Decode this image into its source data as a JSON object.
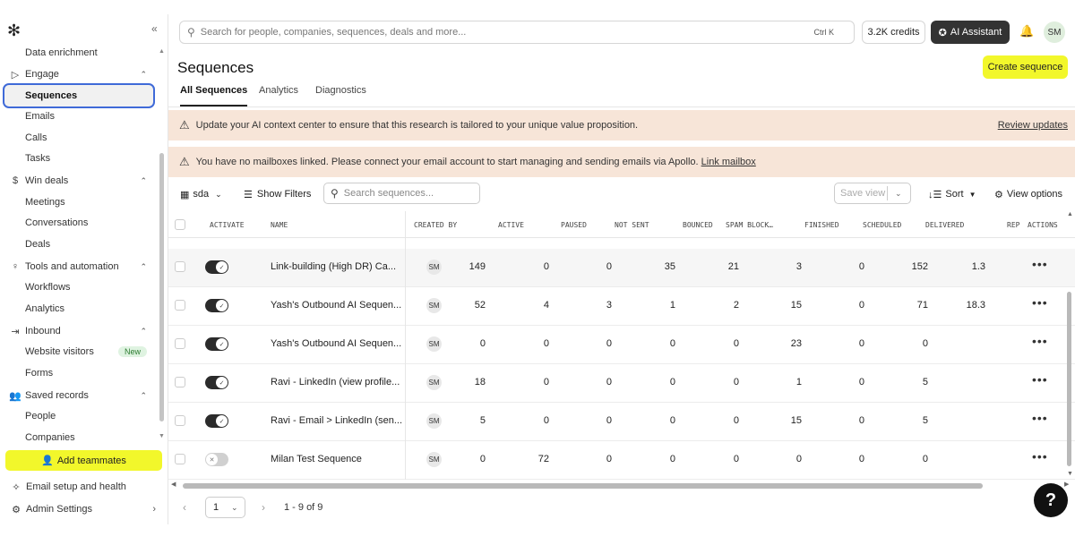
{
  "sidebar": {
    "logo": "✻",
    "collapse": "«",
    "items": [
      {
        "label": "Data enrichment",
        "type": "sub"
      },
      {
        "label": "Engage",
        "type": "section",
        "icon": "send-icon"
      },
      {
        "label": "Sequences",
        "type": "active"
      },
      {
        "label": "Emails",
        "type": "sub"
      },
      {
        "label": "Calls",
        "type": "sub"
      },
      {
        "label": "Tasks",
        "type": "sub"
      },
      {
        "label": "Win deals",
        "type": "section",
        "icon": "dollar-icon"
      },
      {
        "label": "Meetings",
        "type": "sub"
      },
      {
        "label": "Conversations",
        "type": "sub"
      },
      {
        "label": "Deals",
        "type": "sub"
      },
      {
        "label": "Tools and automation",
        "type": "section",
        "icon": "bulb-icon"
      },
      {
        "label": "Workflows",
        "type": "sub"
      },
      {
        "label": "Analytics",
        "type": "sub"
      },
      {
        "label": "Inbound",
        "type": "section",
        "icon": "inbound-icon"
      },
      {
        "label": "Website visitors",
        "type": "sub",
        "badge": "New"
      },
      {
        "label": "Forms",
        "type": "sub"
      },
      {
        "label": "Saved records",
        "type": "section",
        "icon": "people-icon"
      },
      {
        "label": "People",
        "type": "sub"
      },
      {
        "label": "Companies",
        "type": "sub"
      }
    ],
    "add_teammates": "Add teammates",
    "email_setup": "Email setup and health",
    "admin_settings": "Admin Settings"
  },
  "topbar": {
    "search_placeholder": "Search for people, companies, sequences, deals and more...",
    "shortcut": "Ctrl  K",
    "credits": "3.2K credits",
    "ai_assistant": "AI Assistant",
    "avatar": "SM"
  },
  "main": {
    "title": "Sequences",
    "create_button": "Create sequence",
    "tabs": [
      "All Sequences",
      "Analytics",
      "Diagnostics"
    ],
    "banner1": "Update your AI context center to ensure that this research is tailored to your unique value proposition.",
    "banner1_link": "Review updates",
    "banner2": "You have no mailboxes linked. Please connect your email account to start managing and sending emails via Apollo. ",
    "banner2_link": "Link mailbox",
    "toolbar": {
      "view": "sda",
      "show_filters": "Show Filters",
      "search_placeholder": "Search sequences...",
      "save_view": "Save view",
      "sort": "Sort",
      "view_options": "View options"
    }
  },
  "table": {
    "headers": [
      "ACTIVATE",
      "NAME",
      "CREATED BY",
      "ACTIVE",
      "PAUSED",
      "NOT SENT",
      "BOUNCED",
      "SPAM BLOCK…",
      "FINISHED",
      "SCHEDULED",
      "DELIVERED",
      "REP",
      "ACTIONS"
    ],
    "rows": [
      {
        "active_toggle": true,
        "name": "Link-building (High DR) Ca...",
        "created_by": "SM",
        "active": "149",
        "paused": "0",
        "not_sent": "0",
        "bounced": "35",
        "spam": "21",
        "finished": "3",
        "scheduled": "0",
        "delivered": "152",
        "rep": "1.3"
      },
      {
        "active_toggle": true,
        "name": "Yash's Outbound AI Sequen...",
        "created_by": "SM",
        "active": "52",
        "paused": "4",
        "not_sent": "3",
        "bounced": "1",
        "spam": "2",
        "finished": "15",
        "scheduled": "0",
        "delivered": "71",
        "rep": "18.3"
      },
      {
        "active_toggle": true,
        "name": "Yash's Outbound AI Sequen...",
        "created_by": "SM",
        "active": "0",
        "paused": "0",
        "not_sent": "0",
        "bounced": "0",
        "spam": "0",
        "finished": "23",
        "scheduled": "0",
        "delivered": "0",
        "rep": ""
      },
      {
        "active_toggle": true,
        "name": "Ravi - LinkedIn (view profile...",
        "created_by": "SM",
        "active": "18",
        "paused": "0",
        "not_sent": "0",
        "bounced": "0",
        "spam": "0",
        "finished": "1",
        "scheduled": "0",
        "delivered": "5",
        "rep": ""
      },
      {
        "active_toggle": true,
        "name": "Ravi - Email > LinkedIn (sen...",
        "created_by": "SM",
        "active": "5",
        "paused": "0",
        "not_sent": "0",
        "bounced": "0",
        "spam": "0",
        "finished": "15",
        "scheduled": "0",
        "delivered": "5",
        "rep": ""
      },
      {
        "active_toggle": false,
        "name": "Milan Test Sequence",
        "created_by": "SM",
        "active": "0",
        "paused": "72",
        "not_sent": "0",
        "bounced": "0",
        "spam": "0",
        "finished": "0",
        "scheduled": "0",
        "delivered": "0",
        "rep": ""
      }
    ]
  },
  "pager": {
    "page": "1",
    "range": "1 - 9 of 9"
  },
  "colors": {
    "accent": "#f2f72b",
    "active_border": "#3f6ad8",
    "banner": "#f7e5d8"
  }
}
